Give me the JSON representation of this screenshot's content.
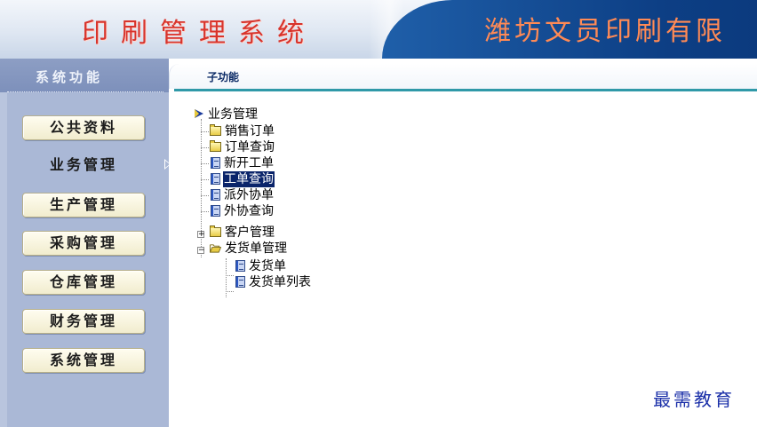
{
  "header": {
    "system_title": "印刷管理系统",
    "company_name": "潍坊文员印刷有限"
  },
  "sidebar": {
    "title": "系统功能",
    "items": [
      {
        "label": "公共资料",
        "active": false
      },
      {
        "label": "业务管理",
        "active": true
      },
      {
        "label": "生产管理",
        "active": false
      },
      {
        "label": "采购管理",
        "active": false
      },
      {
        "label": "仓库管理",
        "active": false
      },
      {
        "label": "财务管理",
        "active": false
      },
      {
        "label": "系统管理",
        "active": false
      }
    ]
  },
  "main": {
    "tab_label": "子功能",
    "tree": {
      "root": "业务管理",
      "nodes": [
        {
          "label": "销售订单",
          "icon": "folder-icon"
        },
        {
          "label": "订单查询",
          "icon": "folder-icon"
        },
        {
          "label": "新开工单",
          "icon": "page-icon"
        },
        {
          "label": "工单查询",
          "icon": "page-icon",
          "selected": true
        },
        {
          "label": "派外协单",
          "icon": "page-icon"
        },
        {
          "label": "外协查询",
          "icon": "page-icon"
        },
        {
          "label": "客户管理",
          "icon": "folder-icon",
          "expander": "+"
        },
        {
          "label": "发货单管理",
          "icon": "open-folder-icon",
          "expander": "-"
        },
        {
          "label": "发货单",
          "icon": "page-icon",
          "child": true
        },
        {
          "label": "发货单列表",
          "icon": "page-icon",
          "child": true
        }
      ]
    }
  },
  "watermark": "最需教育",
  "colors": {
    "title_red": "#d8342c",
    "banner_blue": "#0d3f85",
    "sidebar_bg": "#aab8d6",
    "tab_rule": "#2f99a8",
    "selection": "#0a246a"
  }
}
